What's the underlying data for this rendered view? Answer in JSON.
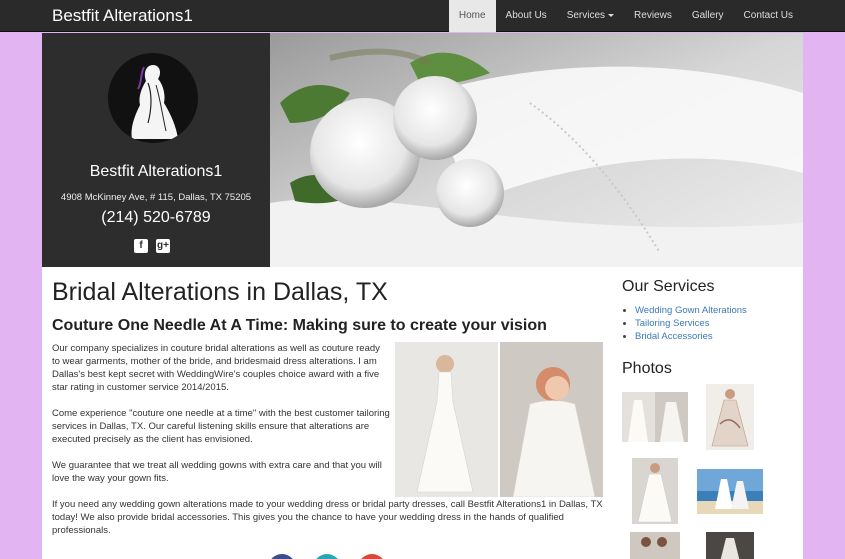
{
  "brand": "Bestfit Alterations1",
  "nav": {
    "items": [
      {
        "label": "Home",
        "active": true
      },
      {
        "label": "About Us"
      },
      {
        "label": "Services",
        "dropdown": true
      },
      {
        "label": "Reviews"
      },
      {
        "label": "Gallery"
      },
      {
        "label": "Contact Us"
      }
    ]
  },
  "hero": {
    "business_name": "Bestfit Alterations1",
    "address": "4908 McKinney Ave, # 115, Dallas, TX 75205",
    "phone": "(214) 520-6789",
    "social": [
      {
        "icon": "facebook-icon",
        "glyph": "f"
      },
      {
        "icon": "google-plus-icon",
        "glyph": "g+"
      }
    ]
  },
  "main": {
    "title": "Bridal Alterations in Dallas, TX",
    "subtitle": "Couture One Needle At A Time: Making sure to create your vision",
    "paragraphs": [
      "Our company specializes in couture bridal alterations as well as couture ready to wear garments, mother of the bride, and bridesmaid dress alterations. I am Dallas's best kept secret with WeddingWire's couples choice award with a five star rating in customer service 2014/2015.",
      "Come experience \"couture one needle at a time\" with the best customer tailoring services in Dallas, TX. Our careful listening skills ensure that alterations are executed precisely as the client has envisioned.",
      "We guarantee that we treat all wedding gowns with extra care and that you will love the way your gown fits.",
      "If you need any wedding gown alterations made to your wedding dress or bridal party dresses, call Bestfit Alterations1 in Dallas, TX today! We also provide bridal accessories. This gives you the chance to have your wedding dress in the hands of qualified professionals."
    ]
  },
  "sidebar": {
    "services_title": "Our Services",
    "services": [
      "Wedding Gown Alterations",
      "Tailoring Services",
      "Bridal Accessories"
    ],
    "photos_title": "Photos"
  },
  "colors": {
    "page_bg": "#e2b4f1",
    "navbar": "#2a2a2a",
    "link": "#3b79b8"
  }
}
